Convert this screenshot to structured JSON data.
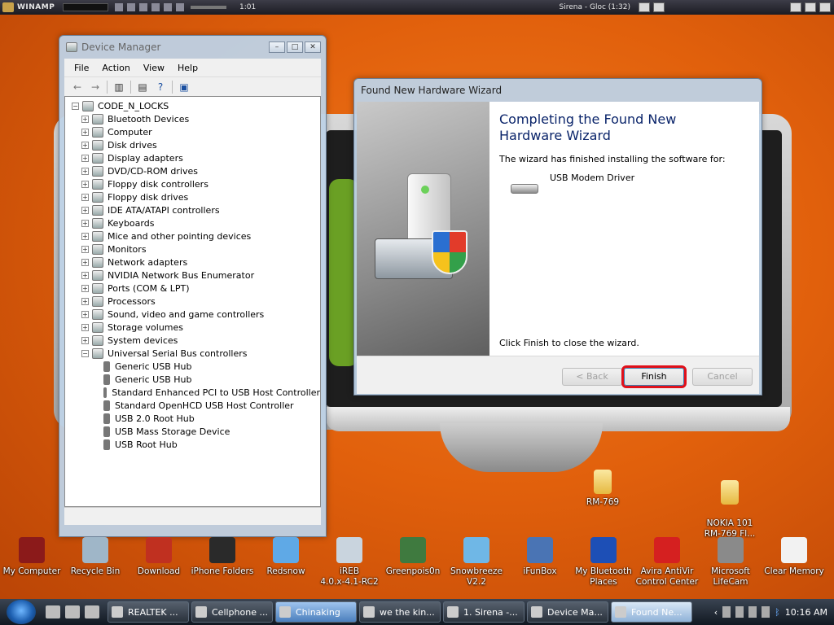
{
  "winamp": {
    "label": "WINAMP",
    "time": "1:01",
    "track": "Sirena - Gloc (1:32)"
  },
  "device_manager": {
    "title": "Device Manager",
    "menu": [
      "File",
      "Action",
      "View",
      "Help"
    ],
    "root": "CODE_N_LOCKS",
    "categories": [
      "Bluetooth Devices",
      "Computer",
      "Disk drives",
      "Display adapters",
      "DVD/CD-ROM drives",
      "Floppy disk controllers",
      "Floppy disk drives",
      "IDE ATA/ATAPI controllers",
      "Keyboards",
      "Mice and other pointing devices",
      "Monitors",
      "Network adapters",
      "NVIDIA Network Bus Enumerator",
      "Ports (COM & LPT)",
      "Processors",
      "Sound, video and game controllers",
      "Storage volumes",
      "System devices",
      "Universal Serial Bus controllers"
    ],
    "usb_children": [
      "Generic USB Hub",
      "Generic USB Hub",
      "Standard Enhanced PCI to USB Host Controller",
      "Standard OpenHCD USB Host Controller",
      "USB 2.0 Root Hub",
      "USB Mass Storage Device",
      "USB Root Hub"
    ]
  },
  "wizard": {
    "title": "Found New Hardware Wizard",
    "heading": "Completing the Found New Hardware Wizard",
    "intro": "The wizard has finished installing the software for:",
    "device": "USB Modem Driver",
    "close_text": "Click Finish to close the wizard.",
    "back_label": "< Back",
    "finish_label": "Finish",
    "cancel_label": "Cancel"
  },
  "desktop": {
    "folders": [
      "RM-769",
      "NOKIA 101\nRM-769 Fl..."
    ],
    "icons": [
      "My Computer",
      "Recycle Bin",
      "Download",
      "iPhone Folders",
      "Redsnow",
      "iREB\n4.0.x-4.1-RC2",
      "Greenpois0n",
      "Snowbreeze\nV2.2",
      "iFunBox",
      "My Bluetooth\nPlaces",
      "Avira AntiVir\nControl Center",
      "Microsoft\nLifeCam",
      "Clear Memory"
    ]
  },
  "taskbar": {
    "tasks": [
      "REALTEK ...",
      "Cellphone ...",
      "Chinaking",
      "we the kin...",
      "1. Sirena -...",
      "Device Ma...",
      "Found Ne..."
    ],
    "clock": "10:16 AM"
  }
}
